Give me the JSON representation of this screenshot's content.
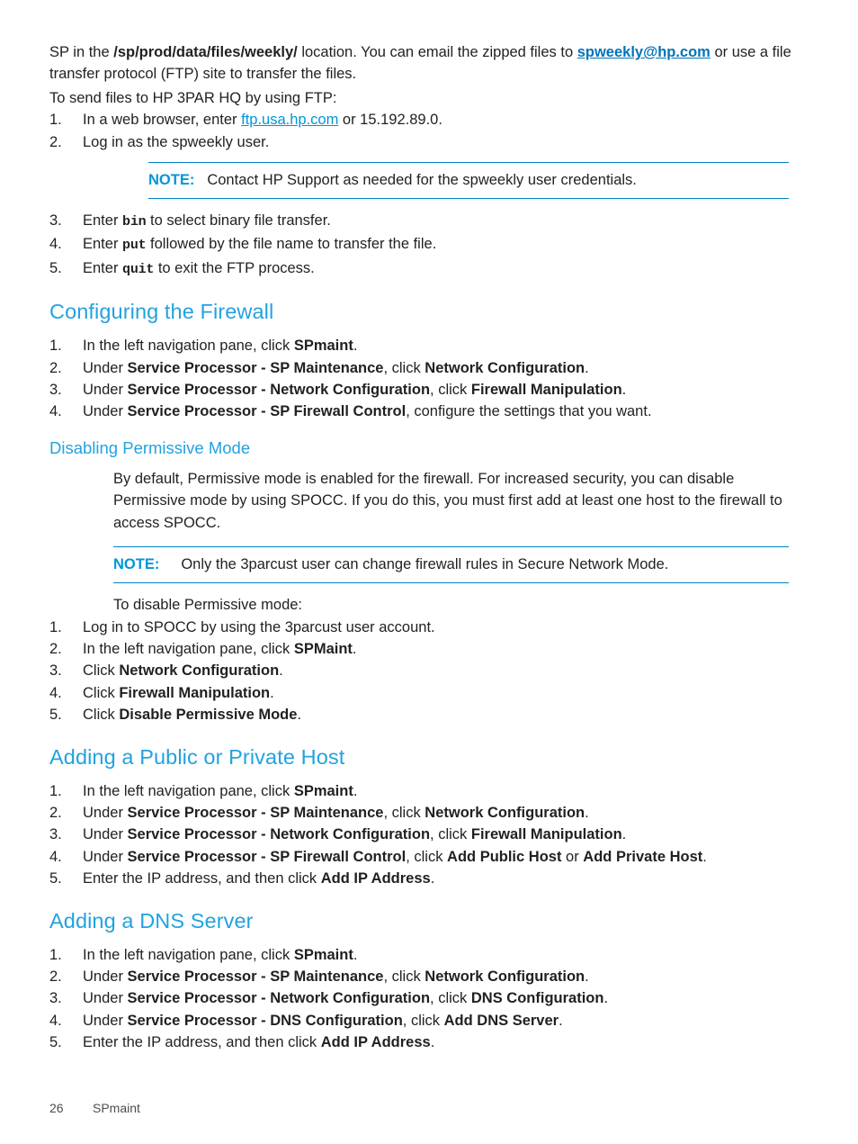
{
  "document": {
    "footer": {
      "page_number": "26",
      "chapter": "SPmaint"
    }
  },
  "intro": {
    "p1_a": "SP in the ",
    "p1_path": "/sp/prod/data/files/weekly/",
    "p1_b": " location. You can email the zipped files to ",
    "p1_email": "spweekly@hp.com",
    "p1_c": " or use a file transfer protocol (FTP) site to transfer the files.",
    "p2": "To send files to HP 3PAR HQ by using FTP:",
    "steps": [
      {
        "num": "1.",
        "pre": "In a web browser, enter ",
        "link": "ftp.usa.hp.com",
        "post": " or 15.192.89.0."
      },
      {
        "num": "2.",
        "text": "Log in as the spweekly user."
      }
    ],
    "note": {
      "label": "NOTE:",
      "text": "Contact HP Support as needed for the spweekly user credentials."
    },
    "steps_after": [
      {
        "num": "3.",
        "pre": "Enter ",
        "code": "bin",
        "post": " to select binary file transfer."
      },
      {
        "num": "4.",
        "pre": "Enter ",
        "code": "put",
        "post": " followed by the file name to transfer the file."
      },
      {
        "num": "5.",
        "pre": "Enter ",
        "code": "quit",
        "post": " to exit the FTP process."
      }
    ]
  },
  "configuring_firewall": {
    "heading": "Configuring the Firewall",
    "steps": [
      {
        "num": "1.",
        "pre": "In the left navigation pane, click ",
        "bold1": "SPmaint",
        "mid": "",
        "bold2": "",
        "post": "."
      },
      {
        "num": "2.",
        "pre": "Under ",
        "bold1": "Service Processor - SP Maintenance",
        "mid": ", click ",
        "bold2": "Network Configuration",
        "post": "."
      },
      {
        "num": "3.",
        "pre": "Under ",
        "bold1": "Service Processor - Network Configuration",
        "mid": ", click ",
        "bold2": "Firewall Manipulation",
        "post": "."
      },
      {
        "num": "4.",
        "pre": "Under ",
        "bold1": "Service Processor - SP Firewall Control",
        "mid": ", configure the settings that you want",
        "bold2": "",
        "post": "."
      }
    ]
  },
  "disabling_permissive": {
    "heading": "Disabling Permissive Mode",
    "body": "By default, Permissive mode is enabled for the firewall. For increased security, you can disable Permissive mode by using SPOCC. If you do this, you must first add at least one host to the firewall to access SPOCC.",
    "note": {
      "label": "NOTE:",
      "text": "Only the 3parcust user can change firewall rules in Secure Network Mode."
    },
    "lead_in": "To disable Permissive mode:",
    "steps": [
      {
        "num": "1.",
        "pre": "Log in to SPOCC by using the 3parcust user account.",
        "bold1": "",
        "post": ""
      },
      {
        "num": "2.",
        "pre": "In the left navigation pane, click ",
        "bold1": "SPMaint",
        "post": "."
      },
      {
        "num": "3.",
        "pre": "Click ",
        "bold1": "Network Configuration",
        "post": "."
      },
      {
        "num": "4.",
        "pre": "Click ",
        "bold1": "Firewall Manipulation",
        "post": "."
      },
      {
        "num": "5.",
        "pre": "Click ",
        "bold1": "Disable Permissive Mode",
        "post": "."
      }
    ]
  },
  "adding_host": {
    "heading": "Adding a Public or Private Host",
    "steps": [
      {
        "num": "1.",
        "pre": "In the left navigation pane, click ",
        "bold1": "SPmaint",
        "mid": "",
        "bold2": "",
        "mid2": "",
        "bold3": "",
        "post": "."
      },
      {
        "num": "2.",
        "pre": "Under ",
        "bold1": "Service Processor - SP Maintenance",
        "mid": ", click ",
        "bold2": "Network Configuration",
        "mid2": "",
        "bold3": "",
        "post": "."
      },
      {
        "num": "3.",
        "pre": "Under ",
        "bold1": "Service Processor - Network Configuration",
        "mid": ", click ",
        "bold2": "Firewall Manipulation",
        "mid2": "",
        "bold3": "",
        "post": "."
      },
      {
        "num": "4.",
        "pre": "Under ",
        "bold1": "Service Processor - SP Firewall Control",
        "mid": ", click ",
        "bold2": "Add Public Host",
        "mid2": " or ",
        "bold3": "Add Private Host",
        "post": "."
      },
      {
        "num": "5.",
        "pre": "Enter the IP address, and then click ",
        "bold1": "Add IP Address",
        "mid": "",
        "bold2": "",
        "mid2": "",
        "bold3": "",
        "post": "."
      }
    ]
  },
  "adding_dns": {
    "heading": "Adding a DNS Server",
    "steps": [
      {
        "num": "1.",
        "pre": "In the left navigation pane, click ",
        "bold1": "SPmaint",
        "mid": "",
        "bold2": "",
        "post": "."
      },
      {
        "num": "2.",
        "pre": "Under ",
        "bold1": "Service Processor - SP Maintenance",
        "mid": ", click ",
        "bold2": "Network Configuration",
        "post": "."
      },
      {
        "num": "3.",
        "pre": "Under ",
        "bold1": "Service Processor - Network Configuration",
        "mid": ", click ",
        "bold2": "DNS Configuration",
        "post": "."
      },
      {
        "num": "4.",
        "pre": "Under ",
        "bold1": "Service Processor - DNS Configuration",
        "mid": ", click ",
        "bold2": "Add DNS Server",
        "post": "."
      },
      {
        "num": "5.",
        "pre": "Enter the IP address, and then click ",
        "bold1": "Add IP Address",
        "mid": "",
        "bold2": "",
        "post": "."
      }
    ]
  },
  "colors": {
    "heading_blue": "#22a2df",
    "link_blue": "#0096d6",
    "rule_blue": "#0084c9",
    "body_black": "#231f20"
  }
}
